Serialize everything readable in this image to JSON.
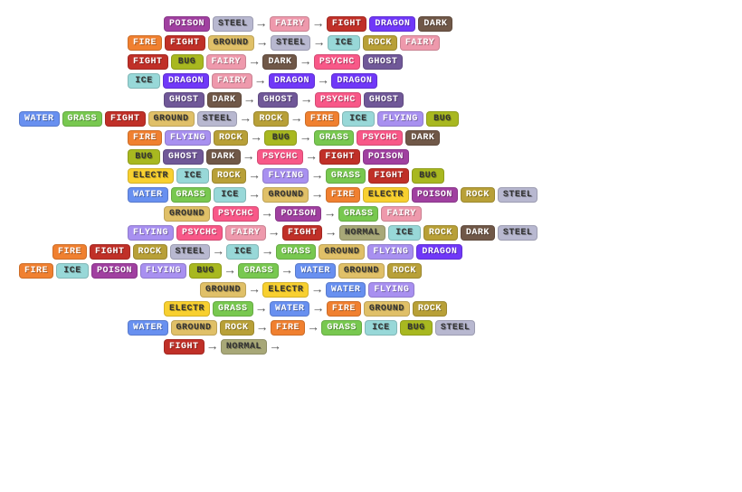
{
  "rows": [
    {
      "indent": 4,
      "inputs": [
        {
          "label": "POISON",
          "type": "poison"
        },
        {
          "label": "STEEL",
          "type": "steel"
        }
      ],
      "mid": {
        "label": "FAIRY",
        "type": "fairy"
      },
      "outputs": [
        {
          "label": "FIGHT",
          "type": "fight"
        },
        {
          "label": "DRAGON",
          "type": "dragon"
        },
        {
          "label": "DARK",
          "type": "dark"
        }
      ]
    },
    {
      "indent": 3,
      "inputs": [
        {
          "label": "FIRE",
          "type": "fire"
        },
        {
          "label": "FIGHT",
          "type": "fight"
        },
        {
          "label": "GROUND",
          "type": "ground"
        }
      ],
      "mid": {
        "label": "STEEL",
        "type": "steel"
      },
      "outputs": [
        {
          "label": "ICE",
          "type": "ice"
        },
        {
          "label": "ROCK",
          "type": "rock"
        },
        {
          "label": "FAIRY",
          "type": "fairy"
        }
      ]
    },
    {
      "indent": 3,
      "inputs": [
        {
          "label": "FIGHT",
          "type": "fight"
        },
        {
          "label": "BUG",
          "type": "bug"
        },
        {
          "label": "FAIRY",
          "type": "fairy"
        }
      ],
      "mid": {
        "label": "DARK",
        "type": "dark"
      },
      "outputs": [
        {
          "label": "PSYCHC",
          "type": "psychic"
        },
        {
          "label": "GHOST",
          "type": "ghost"
        }
      ]
    },
    {
      "indent": 3,
      "inputs": [
        {
          "label": "ICE",
          "type": "ice"
        },
        {
          "label": "DRAGON",
          "type": "dragon"
        },
        {
          "label": "FAIRY",
          "type": "fairy"
        }
      ],
      "mid": {
        "label": "DRAGON",
        "type": "dragon"
      },
      "outputs": [
        {
          "label": "DRAGON",
          "type": "dragon"
        }
      ]
    },
    {
      "indent": 4,
      "inputs": [
        {
          "label": "GHOST",
          "type": "ghost"
        },
        {
          "label": "DARK",
          "type": "dark"
        }
      ],
      "mid": {
        "label": "GHOST",
        "type": "ghost"
      },
      "outputs": [
        {
          "label": "PSYCHC",
          "type": "psychic"
        },
        {
          "label": "GHOST",
          "type": "ghost"
        }
      ]
    },
    {
      "indent": 0,
      "prefix": [
        {
          "label": "WATER",
          "type": "water"
        },
        {
          "label": "GRASS",
          "type": "grass"
        }
      ],
      "inputs": [
        {
          "label": "FIGHT",
          "type": "fight"
        },
        {
          "label": "GROUND",
          "type": "ground"
        },
        {
          "label": "STEEL",
          "type": "steel"
        }
      ],
      "mid": {
        "label": "ROCK",
        "type": "rock"
      },
      "outputs": [
        {
          "label": "FIRE",
          "type": "fire"
        },
        {
          "label": "ICE",
          "type": "ice"
        },
        {
          "label": "FLYING",
          "type": "flying"
        },
        {
          "label": "BUG",
          "type": "bug"
        }
      ]
    },
    {
      "indent": 3,
      "inputs": [
        {
          "label": "FIRE",
          "type": "fire"
        },
        {
          "label": "FLYING",
          "type": "flying"
        },
        {
          "label": "ROCK",
          "type": "rock"
        }
      ],
      "mid": {
        "label": "BUG",
        "type": "bug"
      },
      "outputs": [
        {
          "label": "GRASS",
          "type": "grass"
        },
        {
          "label": "PSYCHC",
          "type": "psychic"
        },
        {
          "label": "DARK",
          "type": "dark"
        }
      ]
    },
    {
      "indent": 3,
      "inputs": [
        {
          "label": "BUG",
          "type": "bug"
        },
        {
          "label": "GHOST",
          "type": "ghost"
        },
        {
          "label": "DARK",
          "type": "dark"
        }
      ],
      "mid": {
        "label": "PSYCHC",
        "type": "psychic"
      },
      "outputs": [
        {
          "label": "FIGHT",
          "type": "fight"
        },
        {
          "label": "POISON",
          "type": "poison"
        }
      ]
    },
    {
      "indent": 3,
      "inputs": [
        {
          "label": "ELECTR",
          "type": "electric"
        },
        {
          "label": "ICE",
          "type": "ice"
        },
        {
          "label": "ROCK",
          "type": "rock"
        }
      ],
      "mid": {
        "label": "FLYING",
        "type": "flying"
      },
      "outputs": [
        {
          "label": "GRASS",
          "type": "grass"
        },
        {
          "label": "FIGHT",
          "type": "fight"
        },
        {
          "label": "BUG",
          "type": "bug"
        }
      ]
    },
    {
      "indent": 3,
      "inputs": [
        {
          "label": "WATER",
          "type": "water"
        },
        {
          "label": "GRASS",
          "type": "grass"
        },
        {
          "label": "ICE",
          "type": "ice"
        }
      ],
      "mid": {
        "label": "GROUND",
        "type": "ground"
      },
      "outputs": [
        {
          "label": "FIRE",
          "type": "fire"
        },
        {
          "label": "ELECTR",
          "type": "electric"
        },
        {
          "label": "POISON",
          "type": "poison"
        },
        {
          "label": "ROCK",
          "type": "rock"
        },
        {
          "label": "STEEL",
          "type": "steel"
        }
      ]
    },
    {
      "indent": 4,
      "inputs": [
        {
          "label": "GROUND",
          "type": "ground"
        },
        {
          "label": "PSYCHC",
          "type": "psychic"
        }
      ],
      "mid": {
        "label": "POISON",
        "type": "poison"
      },
      "outputs": [
        {
          "label": "GRASS",
          "type": "grass"
        },
        {
          "label": "FAIRY",
          "type": "fairy"
        }
      ]
    },
    {
      "indent": 3,
      "inputs": [
        {
          "label": "FLYING",
          "type": "flying"
        },
        {
          "label": "PSYCHC",
          "type": "psychic"
        },
        {
          "label": "FAIRY",
          "type": "fairy"
        }
      ],
      "mid": {
        "label": "FIGHT",
        "type": "fight"
      },
      "outputs": [
        {
          "label": "NORMAL",
          "type": "normal"
        },
        {
          "label": "ICE",
          "type": "ice"
        },
        {
          "label": "ROCK",
          "type": "rock"
        },
        {
          "label": "DARK",
          "type": "dark"
        },
        {
          "label": "STEEL",
          "type": "steel"
        }
      ]
    },
    {
      "indent": 2,
      "prefix": [
        {
          "label": "FIRE",
          "type": "fire"
        }
      ],
      "inputs": [
        {
          "label": "FIGHT",
          "type": "fight"
        },
        {
          "label": "ROCK",
          "type": "rock"
        },
        {
          "label": "STEEL",
          "type": "steel"
        }
      ],
      "mid": {
        "label": "ICE",
        "type": "ice"
      },
      "outputs": [
        {
          "label": "GRASS",
          "type": "grass"
        },
        {
          "label": "GROUND",
          "type": "ground"
        },
        {
          "label": "FLYING",
          "type": "flying"
        },
        {
          "label": "DRAGON",
          "type": "dragon"
        }
      ]
    },
    {
      "indent": 0,
      "prefix": [
        {
          "label": "FIRE",
          "type": "fire"
        },
        {
          "label": "ICE",
          "type": "ice"
        },
        {
          "label": "POISON",
          "type": "poison"
        }
      ],
      "inputs": [
        {
          "label": "FLYING",
          "type": "flying"
        },
        {
          "label": "BUG",
          "type": "bug"
        }
      ],
      "mid": {
        "label": "GRASS",
        "type": "grass"
      },
      "outputs": [
        {
          "label": "WATER",
          "type": "water"
        },
        {
          "label": "GROUND",
          "type": "ground"
        },
        {
          "label": "ROCK",
          "type": "rock"
        }
      ]
    },
    {
      "indent": 5,
      "inputs": [
        {
          "label": "GROUND",
          "type": "ground"
        }
      ],
      "mid": {
        "label": "ELECTR",
        "type": "electric"
      },
      "outputs": [
        {
          "label": "WATER",
          "type": "water"
        },
        {
          "label": "FLYING",
          "type": "flying"
        }
      ]
    },
    {
      "indent": 4,
      "inputs": [
        {
          "label": "ELECTR",
          "type": "electric"
        },
        {
          "label": "GRASS",
          "type": "grass"
        }
      ],
      "mid": {
        "label": "WATER",
        "type": "water"
      },
      "outputs": [
        {
          "label": "FIRE",
          "type": "fire"
        },
        {
          "label": "GROUND",
          "type": "ground"
        },
        {
          "label": "ROCK",
          "type": "rock"
        }
      ]
    },
    {
      "indent": 3,
      "inputs": [
        {
          "label": "WATER",
          "type": "water"
        },
        {
          "label": "GROUND",
          "type": "ground"
        },
        {
          "label": "ROCK",
          "type": "rock"
        }
      ],
      "mid": {
        "label": "FIRE",
        "type": "fire"
      },
      "outputs": [
        {
          "label": "GRASS",
          "type": "grass"
        },
        {
          "label": "ICE",
          "type": "ice"
        },
        {
          "label": "BUG",
          "type": "bug"
        },
        {
          "label": "STEEL",
          "type": "steel"
        }
      ]
    },
    {
      "indent": 4,
      "inputs": [
        {
          "label": "FIGHT",
          "type": "fight"
        }
      ],
      "mid": {
        "label": "NORMAL",
        "type": "normal"
      },
      "outputs": []
    }
  ]
}
